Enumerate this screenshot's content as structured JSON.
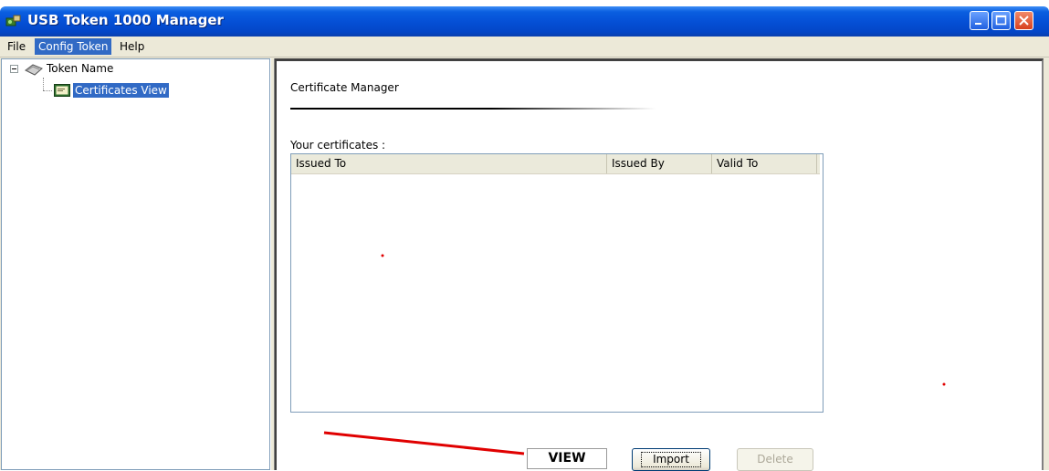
{
  "window": {
    "title": "USB Token 1000 Manager",
    "icon": "usb-token-app-icon",
    "controls": [
      "minimize-icon",
      "maximize-icon",
      "close-icon"
    ]
  },
  "menu": {
    "items": [
      {
        "label": "File"
      },
      {
        "label": "Config Token",
        "selected": true
      },
      {
        "label": "Help"
      }
    ]
  },
  "tree": {
    "root": {
      "label": "Token Name",
      "icon": "token-icon",
      "expanded": true
    },
    "child": {
      "label": "Certificates View",
      "icon": "certificate-icon",
      "selected": true
    }
  },
  "panel": {
    "title": "Certificate Manager",
    "subtitle": "Your certificates :",
    "columns": [
      "Issued To",
      "Issued By",
      "Valid To"
    ],
    "rows": []
  },
  "buttons": {
    "view": "VIEW",
    "import": "Import",
    "delete": "Delete",
    "delete_enabled": false
  },
  "colors": {
    "titlebar": "#0550d6",
    "selection": "#316ac5",
    "annotation": "#e00000"
  }
}
